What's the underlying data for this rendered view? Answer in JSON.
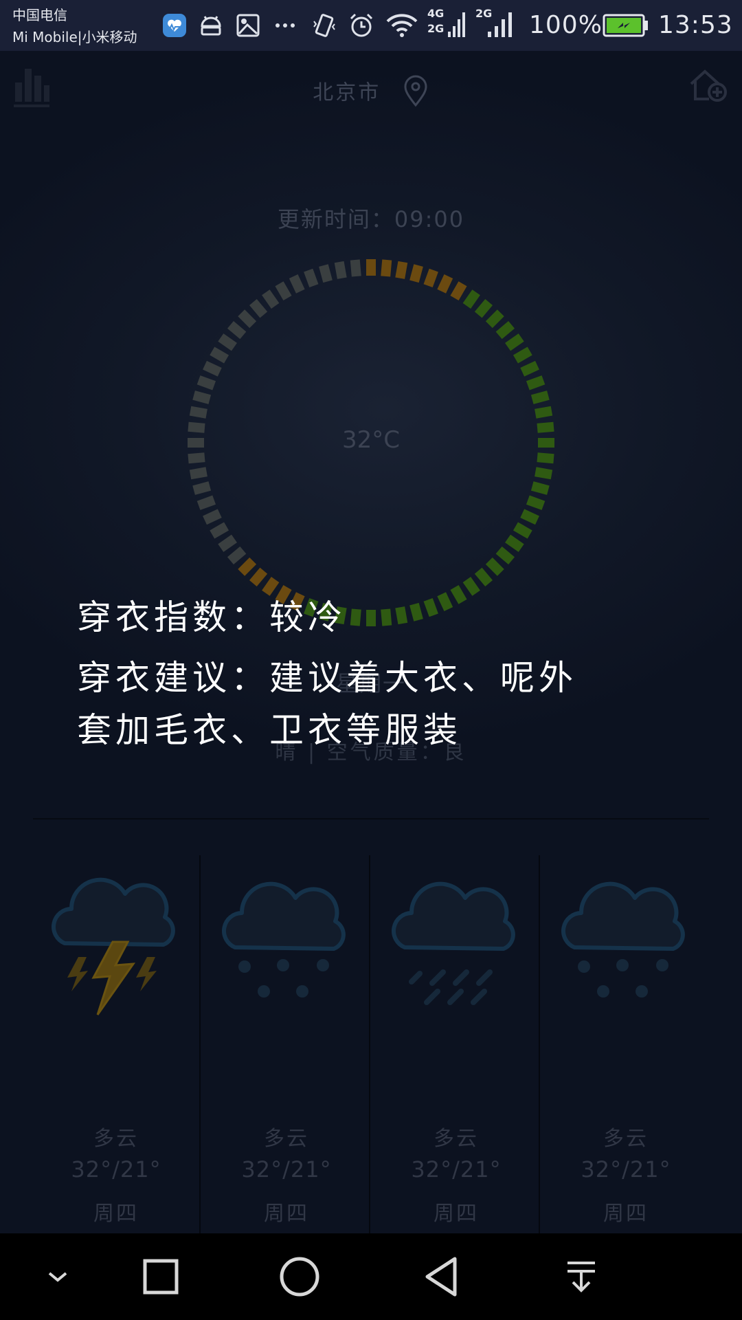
{
  "status_bar": {
    "carrier_line1": "中国电信",
    "carrier_line2": "Mi Mobile|小米移动",
    "network1": "4G",
    "network1b": "2G",
    "network2": "2G",
    "battery": "100%",
    "time": "13:53",
    "icons": [
      "health-app-icon",
      "android-icon",
      "image-icon",
      "more-icon",
      "vibrate-icon",
      "alarm-icon",
      "wifi-icon",
      "signal-icon",
      "battery-icon"
    ]
  },
  "header": {
    "city": "北京市",
    "left_icon": "chart-bars-icon",
    "location_icon": "location-pin-icon",
    "right_icon": "add-city-icon"
  },
  "current": {
    "update_time": "更新时间：09:00",
    "temperature": "32°C",
    "weekday": "星期一",
    "weather_aq": "晴 | 空气质量：良"
  },
  "dressing": {
    "index": "穿衣指数：较冷",
    "advice_line1": "穿衣建议：建议着大衣、呢外",
    "advice_line2": "套加毛衣、卫衣等服装"
  },
  "forecast": [
    {
      "icon": "thunderstorm-icon",
      "condition": "多云",
      "temp": "32°/21°",
      "day": "周四"
    },
    {
      "icon": "snow-cloud-icon",
      "condition": "多云",
      "temp": "32°/21°",
      "day": "周四"
    },
    {
      "icon": "rain-cloud-icon",
      "condition": "多云",
      "temp": "32°/21°",
      "day": "周四"
    },
    {
      "icon": "snow-cloud-icon",
      "condition": "多云",
      "temp": "32°/21°",
      "day": "周四"
    }
  ],
  "nav_bar": {
    "icons": [
      "collapse-icon",
      "recents-icon",
      "home-icon",
      "back-icon",
      "notification-pull-icon"
    ]
  },
  "colors": {
    "ring_cool": "#3a3f40",
    "ring_warm": "#6b4a10",
    "ring_green": "#2f5a12",
    "cloud_stroke": "#15324a",
    "lightning": "#6a5310"
  }
}
